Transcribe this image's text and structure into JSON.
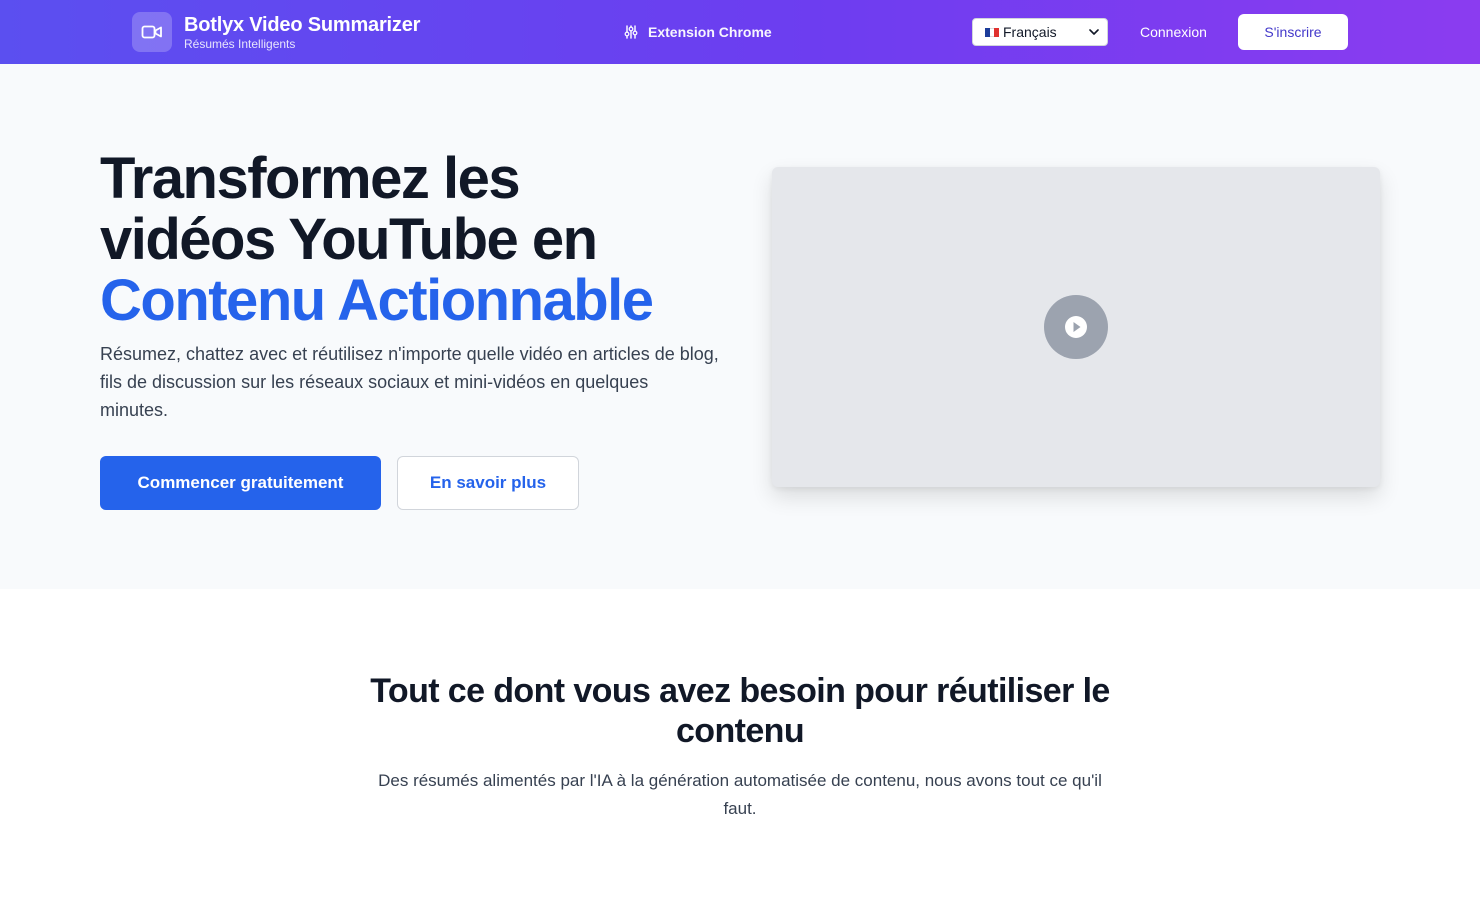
{
  "header": {
    "brand_title": "Botlyx Video Summarizer",
    "brand_subtitle": "Résumés Intelligents",
    "extension_label": "Extension Chrome",
    "language_selected": "Français",
    "login_label": "Connexion",
    "signup_label": "S'inscrire",
    "icons": {
      "brand": "video-camera-icon",
      "extension": "puzzle-icon",
      "language_flag": "france-flag-icon",
      "dropdown": "chevron-down-icon"
    }
  },
  "hero": {
    "title_line1": "Transformez les",
    "title_line2": "vidéos YouTube en",
    "title_accent": "Contenu Actionnable",
    "description": "Résumez, chattez avec et réutilisez n'importe quelle vidéo en articles de blog, fils de discussion sur les réseaux sociaux et mini-vidéos en quelques minutes.",
    "primary_cta": "Commencer gratuitement",
    "secondary_cta": "En savoir plus",
    "video_icon": "play-icon"
  },
  "features": {
    "title": "Tout ce dont vous avez besoin pour réutiliser le contenu",
    "description": "Des résumés alimentés par l'IA à la génération automatisée de contenu, nous avons tout ce qu'il faut."
  },
  "colors": {
    "header_gradient_start": "#5b4ff0",
    "header_gradient_end": "#8b3cf0",
    "accent_blue": "#2563eb",
    "hero_background": "#f8fafc",
    "signup_text": "#4338ca"
  }
}
